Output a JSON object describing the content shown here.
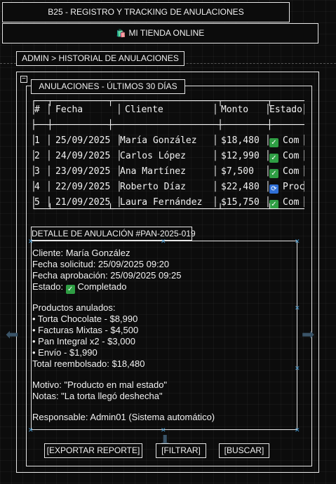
{
  "app": {
    "title": "B25 - REGISTRO Y TRACKING DE ANULACIONES"
  },
  "store": {
    "icon": "shopping-bag-icon",
    "name": "MI TIENDA ONLINE"
  },
  "breadcrumb": {
    "text": "ADMIN > HISTORIAL DE ANULACIONES"
  },
  "table": {
    "title": "ANULACIONES - ÚLTIMOS 30 DÍAS",
    "headers": [
      "#",
      "Fecha",
      "Cliente",
      "Monto",
      "Estado"
    ],
    "rows": [
      {
        "n": "1",
        "fecha": "25/09/2025",
        "cliente": "María González",
        "monto": "$18,480",
        "estado": "Com",
        "estado_icon": "check-icon"
      },
      {
        "n": "2",
        "fecha": "24/09/2025",
        "cliente": "Carlos López",
        "monto": "$12,990",
        "estado": "Com",
        "estado_icon": "check-icon"
      },
      {
        "n": "3",
        "fecha": "23/09/2025",
        "cliente": "Ana Martínez",
        "monto": "$7,500",
        "estado": "Com",
        "estado_icon": "check-icon"
      },
      {
        "n": "4",
        "fecha": "22/09/2025",
        "cliente": "Roberto Díaz",
        "monto": "$22,480",
        "estado": "Proc",
        "estado_icon": "refresh-icon"
      },
      {
        "n": "5",
        "fecha": "21/09/2025",
        "cliente": "Laura Fernández",
        "monto": "$15,750",
        "estado": "Com",
        "estado_icon": "check-icon"
      }
    ]
  },
  "detail": {
    "title": "DETALLE DE ANULACIÓN #PAN-2025-019",
    "cliente": "Cliente: María González",
    "solicitud": "Fecha solicitud: 25/09/2025 09:20",
    "aprobacion": "Fecha aprobación: 25/09/2025 09:25",
    "estado_prefix": "Estado:",
    "estado": "Completado",
    "productos_header": "Productos anulados:",
    "productos": [
      "• Torta Chocolate - $8,990",
      "• Facturas Mixtas - $4,500",
      "• Pan Integral x2 - $3,000",
      "• Envío - $1,990"
    ],
    "total": "Total reembolsado: $18,480",
    "motivo": "Motivo: \"Producto en mal estado\"",
    "notas": "Notas: \"La torta llegó deshecha\"",
    "responsable": "Responsable: Admin01 (Sistema automático)"
  },
  "actions": {
    "export": "[EXPORTAR REPORTE]",
    "filter": "[FILTRAR]",
    "search": "[BUSCAR]"
  },
  "colors": {
    "background": "#0c0c0c",
    "border": "#e6e6e6",
    "success": "#2f9e44",
    "processing": "#2f6fd6",
    "handle": "#4aa0d8"
  }
}
